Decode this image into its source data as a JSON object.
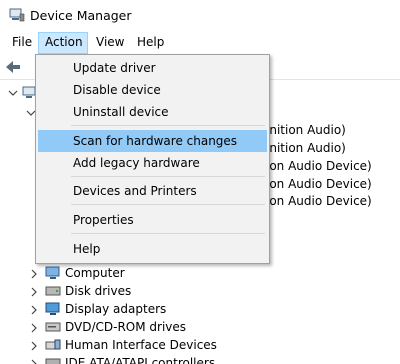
{
  "window": {
    "title": "Device Manager",
    "icon": "device-manager-icon"
  },
  "menubar": {
    "items": [
      "File",
      "Action",
      "View",
      "Help"
    ],
    "active": "Action"
  },
  "context_menu": {
    "items": [
      "Update driver",
      "Disable device",
      "Uninstall device",
      "Scan for hardware changes",
      "Add legacy hardware",
      "Devices and Printers",
      "Properties",
      "Help"
    ],
    "highlighted": "Scan for hardware changes"
  },
  "tree": {
    "obscured_rows": [
      "inition Audio)",
      "inition Audio)",
      "ion Audio Device)",
      "ion Audio Device)",
      "ion Audio Device)"
    ],
    "categories": [
      "Computer",
      "Disk drives",
      "Display adapters",
      "DVD/CD-ROM drives",
      "Human Interface Devices",
      "IDE ATA/ATAPI controllers"
    ]
  },
  "colors": {
    "menu_active": "#cce8ff",
    "ctx_highlight": "#91c9f7",
    "ctx_bg": "#f2f2f2"
  }
}
